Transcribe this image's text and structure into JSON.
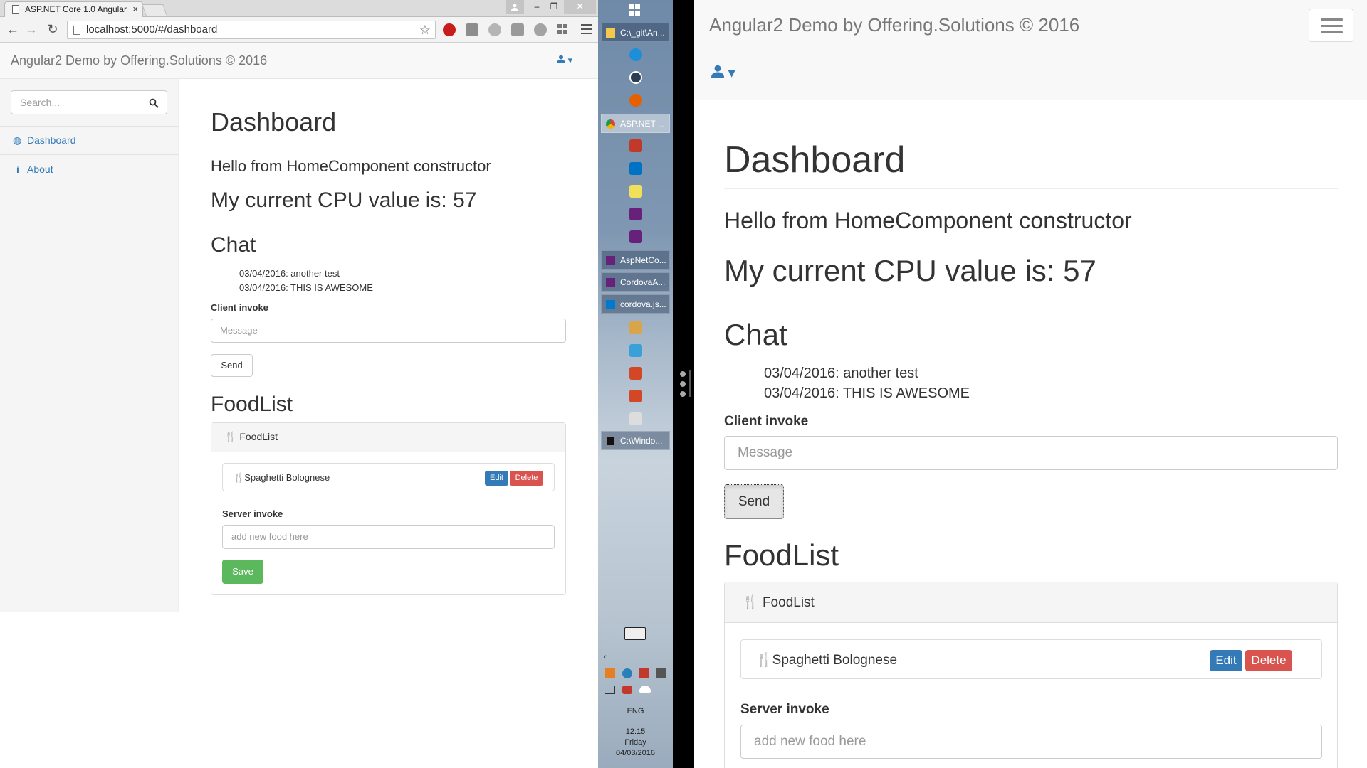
{
  "browser": {
    "tab_title": "ASP.NET Core 1.0 Angular",
    "tab_close": "×",
    "url": "localhost:5000/#/dashboard",
    "window_controls": [
      "–",
      "❐",
      "✕"
    ]
  },
  "app": {
    "brand": "Angular2 Demo by Offering.Solutions © 2016",
    "user_caret": "▾"
  },
  "sidebar": {
    "search_placeholder": "Search...",
    "items": [
      {
        "label": "Dashboard",
        "icon": "dashboard-icon"
      },
      {
        "label": "About",
        "icon": "info-icon"
      }
    ]
  },
  "dashboard": {
    "title": "Dashboard",
    "greeting": "Hello from HomeComponent constructor",
    "cpu_text": "My current CPU value is: 57",
    "chat_title": "Chat",
    "chat_messages": [
      "03/04/2016: another test",
      "03/04/2016: THIS IS AWESOME"
    ],
    "client_invoke_label": "Client invoke",
    "message_placeholder": "Message",
    "send_label": "Send",
    "foodlist_title": "FoodList",
    "panel_heading": "FoodList",
    "food_items": [
      {
        "name": "Spaghetti Bolognese"
      }
    ],
    "edit_label": "Edit",
    "delete_label": "Delete",
    "server_invoke_label": "Server invoke",
    "new_food_placeholder": "add new food here",
    "save_label": "Save"
  },
  "taskbar": {
    "windows": [
      {
        "label": "C:\\_git\\An...",
        "active": false
      },
      {
        "label": "ASP.NET ...",
        "active": true
      },
      {
        "label": "AspNetCo...",
        "active": false
      },
      {
        "label": "CordovaA...",
        "active": false
      },
      {
        "label": "cordova.js...",
        "active": false
      },
      {
        "label": "C:\\Windo...",
        "active": false
      }
    ],
    "language": "ENG",
    "time": "12:15",
    "day": "Friday",
    "date": "04/03/2016"
  },
  "colors": {
    "primary": "#337ab7",
    "danger": "#d9534f",
    "success": "#5cb85c",
    "navbar_bg": "#f8f8f8"
  }
}
